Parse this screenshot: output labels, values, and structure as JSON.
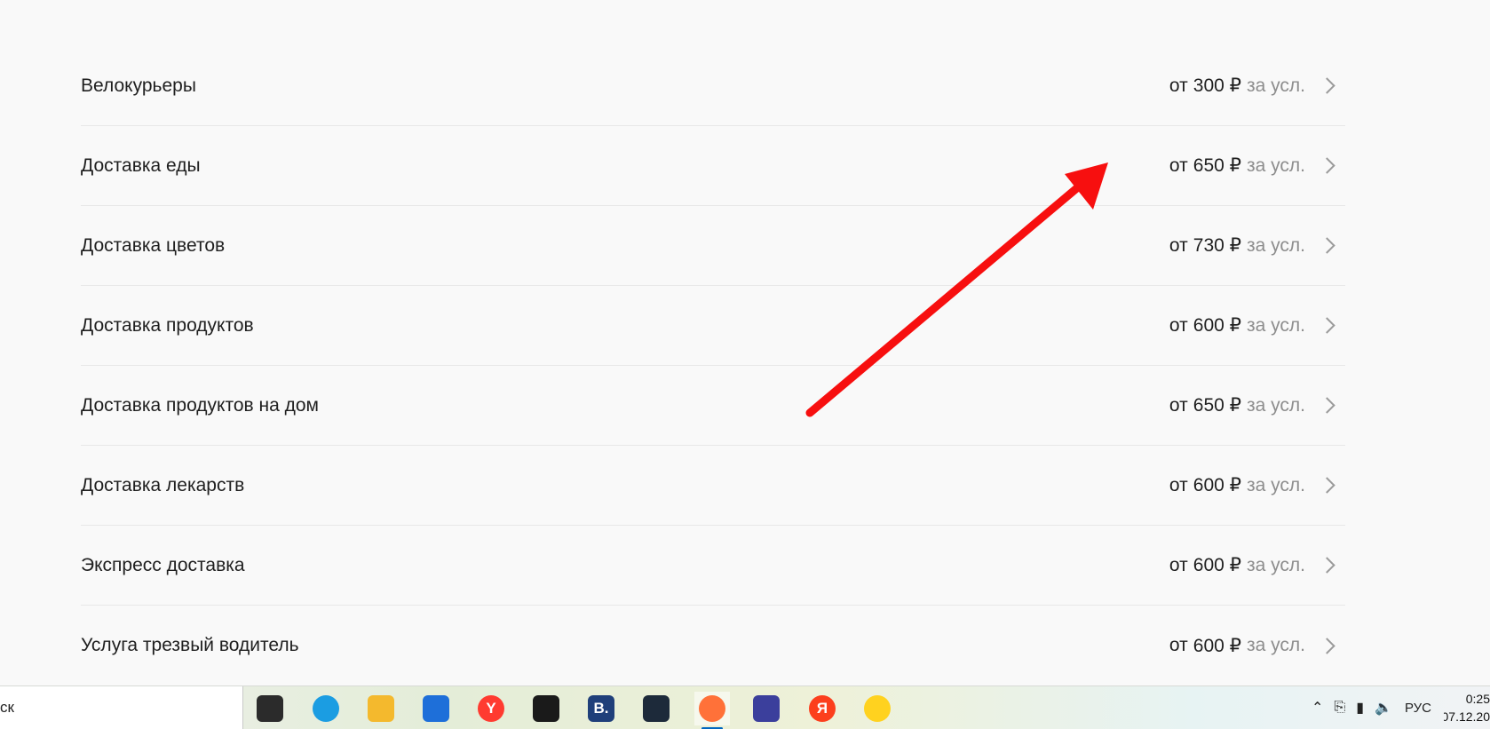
{
  "services": [
    {
      "name": "Велокурьеры",
      "price_from": "от",
      "amount": "300 ₽",
      "unit": "за усл."
    },
    {
      "name": "Доставка еды",
      "price_from": "от",
      "amount": "650 ₽",
      "unit": "за усл."
    },
    {
      "name": "Доставка цветов",
      "price_from": "от",
      "amount": "730 ₽",
      "unit": "за усл."
    },
    {
      "name": "Доставка продуктов",
      "price_from": "от",
      "amount": "600 ₽",
      "unit": "за усл."
    },
    {
      "name": "Доставка продуктов на дом",
      "price_from": "от",
      "amount": "650 ₽",
      "unit": "за усл."
    },
    {
      "name": "Доставка лекарств",
      "price_from": "от",
      "amount": "600 ₽",
      "unit": "за усл."
    },
    {
      "name": "Экспресс доставка",
      "price_from": "от",
      "amount": "600 ₽",
      "unit": "за усл."
    },
    {
      "name": "Услуга трезвый водитель",
      "price_from": "от",
      "amount": "600 ₽",
      "unit": "за усл."
    }
  ],
  "annotation": {
    "color": "#f70f0f"
  },
  "taskbar": {
    "search_text": "ск",
    "apps": [
      {
        "name": "task-view-icon",
        "label": "",
        "color": "#2b2b2b"
      },
      {
        "name": "edge-icon",
        "label": "",
        "color": "#1b9de2"
      },
      {
        "name": "file-explorer-icon",
        "label": "",
        "color": "#f4b92d"
      },
      {
        "name": "mail-icon",
        "label": "",
        "color": "#1e6fd9"
      },
      {
        "name": "yandex-browser-icon",
        "label": "Y",
        "color": "#ff3b30"
      },
      {
        "name": "dropbox-icon",
        "label": "",
        "color": "#1a1a1a"
      },
      {
        "name": "booking-icon",
        "label": "B.",
        "color": "#1f3f7a"
      },
      {
        "name": "vpn-shield-icon",
        "label": "",
        "color": "#1d2a3a"
      },
      {
        "name": "firefox-icon",
        "label": "",
        "color": "#ff7139"
      },
      {
        "name": "remote-desktop-icon",
        "label": "",
        "color": "#3b3f9c"
      },
      {
        "name": "yandex-icon",
        "label": "Я",
        "color": "#fc3f1d"
      },
      {
        "name": "market-icon",
        "label": "",
        "color": "#ffd21f"
      }
    ],
    "lang": "РУС",
    "time": "0:25",
    "date": "07.12.20"
  }
}
